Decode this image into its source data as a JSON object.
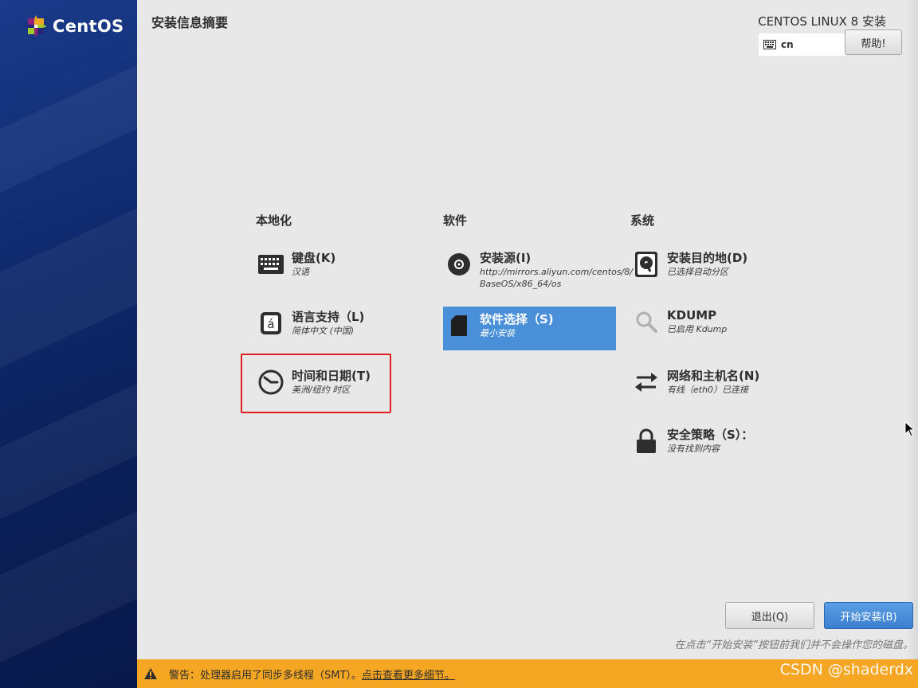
{
  "sidebar": {
    "logo_text": "CentOS"
  },
  "header": {
    "page_title": "安装信息摘要",
    "product_title": "CENTOS LINUX 8 安装",
    "keyboard_layout": "cn",
    "help_label": "帮助!"
  },
  "categories": [
    {
      "label": "本地化",
      "spokes": [
        {
          "title": "键盘(K)",
          "status": "汉语",
          "icon": "keyboard-icon"
        },
        {
          "title": "语言支持（L)",
          "status": "简体中文 (中国)",
          "icon": "language-icon"
        },
        {
          "title": "时间和日期(T)",
          "status": "美洲/纽约 时区",
          "icon": "clock-icon"
        }
      ]
    },
    {
      "label": "软件",
      "spokes": [
        {
          "title": "安装源(I)",
          "status": "http://mirrors.aliyun.com/centos/8/",
          "status2": "BaseOS/x86_64/os",
          "icon": "disc-icon"
        },
        {
          "title": "软件选择（S)",
          "status": "最小安装",
          "icon": "package-icon",
          "selected": true
        }
      ]
    },
    {
      "label": "系统",
      "spokes": [
        {
          "title": "安装目的地(D)",
          "status": "已选择自动分区",
          "icon": "harddisk-icon"
        },
        {
          "title": "KDUMP",
          "status": "已启用 Kdump",
          "icon": "kdump-search-icon"
        },
        {
          "title": "网络和主机名(N)",
          "status": "有线（eth0）已连接",
          "icon": "network-arrows-icon"
        },
        {
          "title": "安全策略（S）：",
          "status": "没有找到内容",
          "icon": "lock-icon"
        }
      ]
    }
  ],
  "footer": {
    "quit_label": "退出(Q)",
    "begin_label": "开始安装(B)",
    "note": "在点击“开始安装”按钮前我们并不会操作您的磁盘。"
  },
  "warning": {
    "text": "警告：处理器启用了同步多线程（SMT）。",
    "link": "点击查看更多细节。"
  },
  "watermark": "CSDN @shaderdx",
  "colors": {
    "selected_spoke": "#4a90d9",
    "warning_bar": "#f5a623",
    "highlight_box": "#e02020",
    "primary_button": "#3b7fcf"
  }
}
